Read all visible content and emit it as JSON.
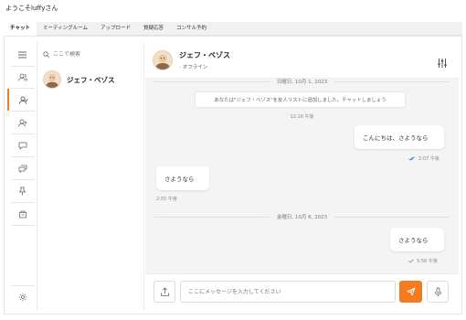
{
  "welcome": "ようこそluffyさん",
  "tabs": [
    {
      "label": "チャット",
      "active": true
    },
    {
      "label": "ミーティングルーム"
    },
    {
      "label": "アップロード"
    },
    {
      "label": "質疑応答"
    },
    {
      "label": "コンサル予約"
    }
  ],
  "rail": {
    "items": [
      "menu-icon",
      "contacts-icon",
      "user-check-icon",
      "user-add-icon",
      "chat-bubble-icon",
      "chats-icon",
      "pin-icon",
      "archive-icon",
      "settings-icon"
    ],
    "active_index": 2
  },
  "search": {
    "placeholder": "ここで検索"
  },
  "contact": {
    "name": "ジェフ・ベゾス"
  },
  "chat": {
    "name": "ジェフ・ベゾス",
    "status": "- オフライン",
    "date1": "日曜日, 10月 1, 2023",
    "system_message": "あなたは\"ジェフ・ベゾス\"を友人リストに追加しました。チャットしましょう",
    "system_time": "12:16 午後",
    "msg1": {
      "text": "こんにちは、さようなら",
      "time": "2:07 午後"
    },
    "msg2": {
      "text": "さようなら",
      "time": "2:55 午後"
    },
    "date2": "金曜日, 10月 6, 2023",
    "msg3": {
      "text": "さようなら",
      "time": "5:56 午後"
    }
  },
  "composer": {
    "placeholder": "ここにメッセージを入力してください"
  },
  "colors": {
    "accent": "#f47b20",
    "read_check": "#4a7fd6"
  }
}
